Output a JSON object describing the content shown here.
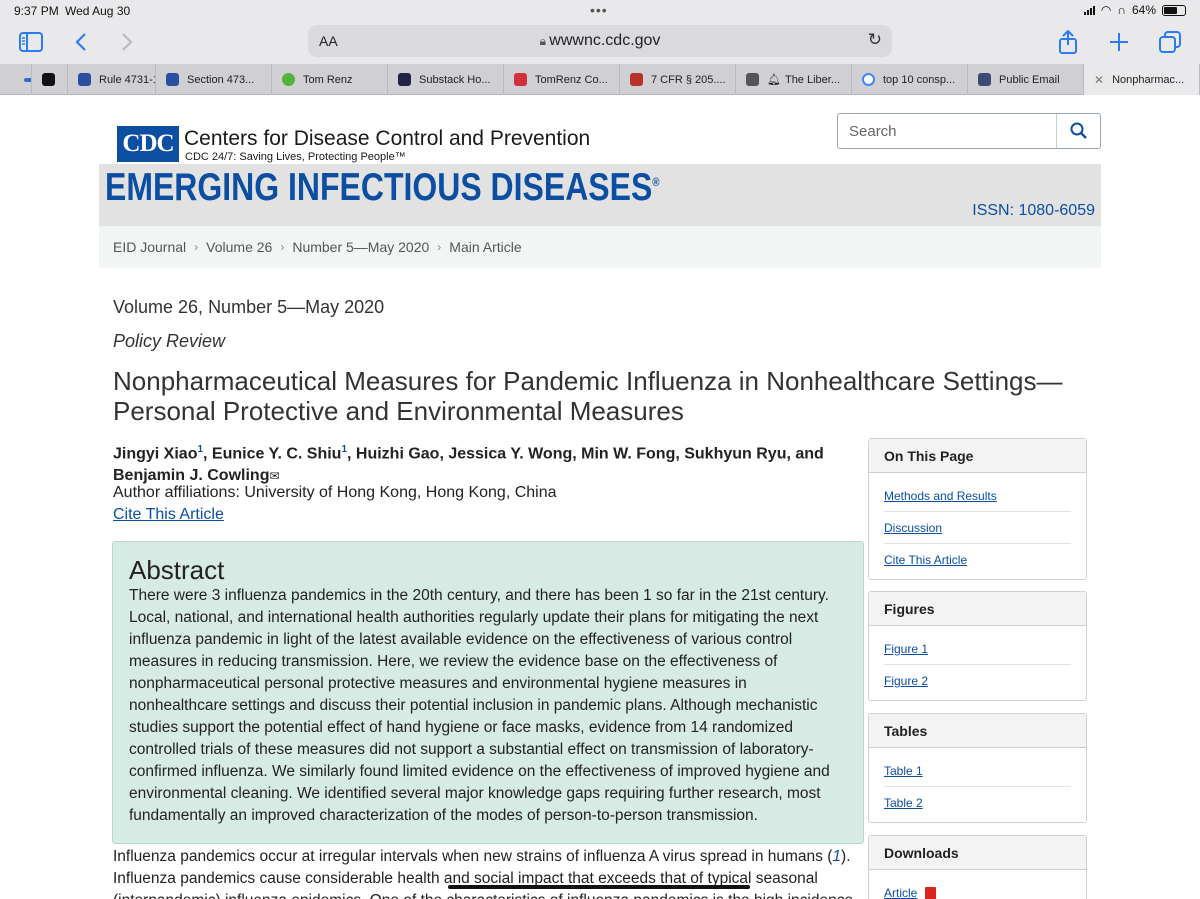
{
  "status_bar": {
    "time": "9:37 PM",
    "date": "Wed Aug 30",
    "battery": "64%"
  },
  "browser": {
    "address_aa": "AA",
    "url": "wwwnc.cdc.gov",
    "tabs": [
      {
        "label": "",
        "color": "#2a6fd6"
      },
      {
        "label": "Rule 4731-1...",
        "color": "#2b4f9e"
      },
      {
        "label": "Section 473...",
        "color": "#2b4f9e"
      },
      {
        "label": "Tom Renz",
        "color": "#54b43a"
      },
      {
        "label": "Substack Ho...",
        "color": "#222244"
      },
      {
        "label": "TomRenz Co...",
        "color": "#d2303a"
      },
      {
        "label": "7 CFR § 205....",
        "color": "#b8322a"
      },
      {
        "label": "The Liber...",
        "color": "#555555"
      },
      {
        "label": "top 10 consp...",
        "color": "#4285f4"
      },
      {
        "label": "Public Email",
        "color": "#3c4a78"
      },
      {
        "label": "Nonpharmac...",
        "color": "#888888"
      }
    ]
  },
  "cdc": {
    "logo_text": "CDC",
    "name": "Centers for Disease Control and Prevention",
    "tagline": "CDC 24/7: Saving Lives, Protecting People™",
    "search_placeholder": "Search",
    "journal_title": "EMERGING INFECTIOUS DISEASES",
    "journal_reg": "®",
    "issn": "ISSN: 1080-6059",
    "breadcrumbs": [
      "EID Journal",
      "Volume 26",
      "Number 5—May 2020",
      "Main Article"
    ]
  },
  "article": {
    "volume": "Volume 26, Number 5—May 2020",
    "type": "Policy Review",
    "title": "Nonpharmaceutical Measures for Pandemic Influenza in Nonhealthcare Settings—Personal Protective and Environmental Measures",
    "authors": {
      "a1": "Jingyi Xiao",
      "sup": "1",
      "a2": "Eunice Y. C. Shiu",
      "rest": ", Huizhi Gao, Jessica Y. Wong, Min W. Fong, Sukhyun Ryu, and Benjamin J. Cowling"
    },
    "affiliation": "Author affiliations: University of Hong Kong, Hong Kong, China",
    "cite_label": "Cite This Article",
    "abstract_heading": "Abstract",
    "abstract_text": "There were 3 influenza pandemics in the 20th century, and there has been 1 so far in the 21st century. Local, national, and international health authorities regularly update their plans for mitigating the next influenza pandemic in light of the latest available evidence on the effectiveness of various control measures in reducing transmission. Here, we review the evidence base on the effectiveness of nonpharmaceutical personal protective measures and environmental hygiene measures in nonhealthcare settings and discuss their potential inclusion in pandemic plans. Although mechanistic studies support the potential effect of hand hygiene or face masks, evidence from 14 randomized controlled trials of these measures did not support a substantial effect on transmission of laboratory-confirmed influenza. We similarly found limited evidence on the effectiveness of improved hygiene and environmental cleaning. We identified several major knowledge gaps requiring further research, most fundamentally an improved characterization of the modes of person-to-person transmission.",
    "body_1": "Influenza pandemics occur at irregular intervals when new strains of influenza A virus spread in humans (",
    "body_ref": "1",
    "body_2": "). Influenza pandemics cause considerable health and social impact that exceeds that of typical seasonal (interpandemic) influenza epidemics. One of the characteristics of influenza pandemics is the high incidence"
  },
  "sidebar": {
    "on_this_page": {
      "title": "On This Page",
      "items": [
        "Methods and Results",
        "Discussion",
        "Cite This Article"
      ]
    },
    "figures": {
      "title": "Figures",
      "items": [
        "Figure 1",
        "Figure 2"
      ]
    },
    "tables": {
      "title": "Tables",
      "items": [
        "Table 1",
        "Table 2"
      ]
    },
    "downloads": {
      "title": "Downloads",
      "items": [
        "Article"
      ]
    }
  }
}
